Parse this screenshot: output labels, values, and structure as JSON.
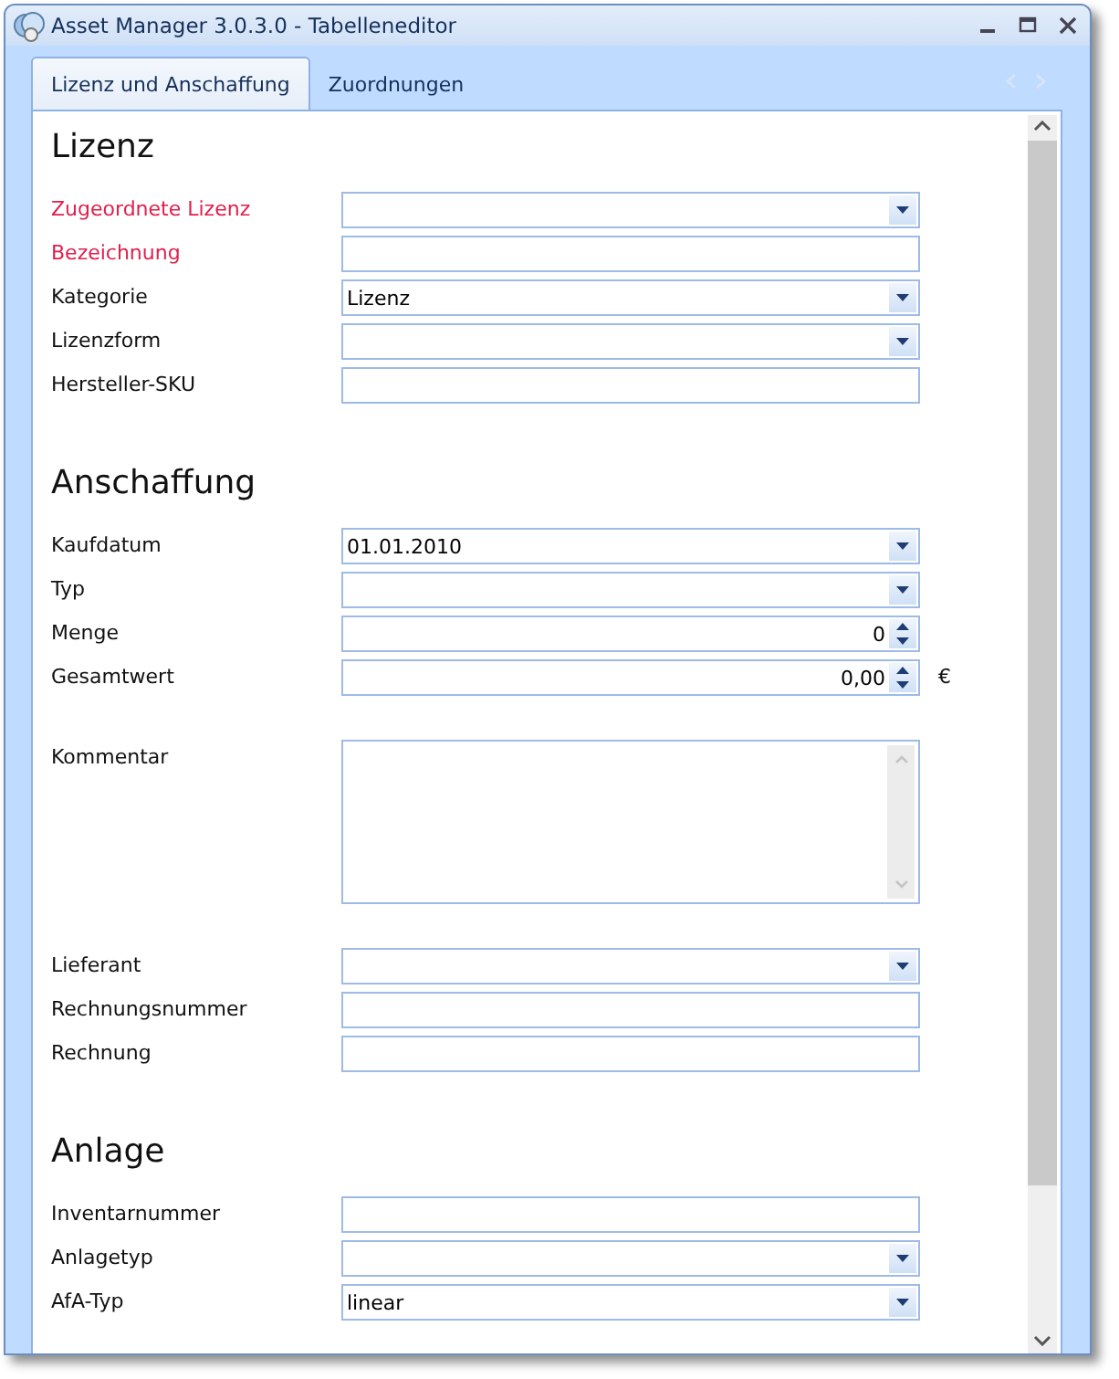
{
  "window": {
    "title": "Asset Manager 3.0.3.0 - Tabelleneditor"
  },
  "tabs": [
    {
      "label": "Lizenz und Anschaffung",
      "selected": true
    },
    {
      "label": "Zuordnungen",
      "selected": false
    }
  ],
  "sections": [
    {
      "title": "Lizenz",
      "groups": [
        [
          {
            "label": "Zugeordnete Lizenz",
            "kind": "combo",
            "required": true
          },
          {
            "label": "Bezeichnung",
            "kind": "text",
            "required": true
          },
          {
            "label": "Kategorie",
            "kind": "combo",
            "required": false,
            "value": "Lizenz"
          },
          {
            "label": "Lizenzform",
            "kind": "combo",
            "required": false
          },
          {
            "label": "Hersteller-SKU",
            "kind": "text",
            "required": false
          }
        ]
      ]
    },
    {
      "title": "Anschaffung",
      "groups": [
        [
          {
            "label": "Kaufdatum",
            "kind": "combo",
            "required": false,
            "value": "01.01.2010"
          },
          {
            "label": "Typ",
            "kind": "combo",
            "required": false
          },
          {
            "label": "Menge",
            "kind": "spin",
            "required": false,
            "value": "0"
          },
          {
            "label": "Gesamtwert",
            "kind": "spin",
            "required": false,
            "value": "0,00",
            "unit": "€"
          }
        ],
        [
          {
            "label": "Kommentar",
            "kind": "memo",
            "required": false
          }
        ],
        [
          {
            "label": "Lieferant",
            "kind": "combo",
            "required": false
          },
          {
            "label": "Rechnungsnummer",
            "kind": "text",
            "required": false
          },
          {
            "label": "Rechnung",
            "kind": "text",
            "required": false
          }
        ]
      ]
    },
    {
      "title": "Anlage",
      "groups": [
        [
          {
            "label": "Inventarnummer",
            "kind": "text",
            "required": false
          },
          {
            "label": "Anlagetyp",
            "kind": "combo",
            "required": false
          },
          {
            "label": "AfA-Typ",
            "kind": "combo",
            "required": false,
            "value": "linear"
          }
        ]
      ]
    }
  ]
}
